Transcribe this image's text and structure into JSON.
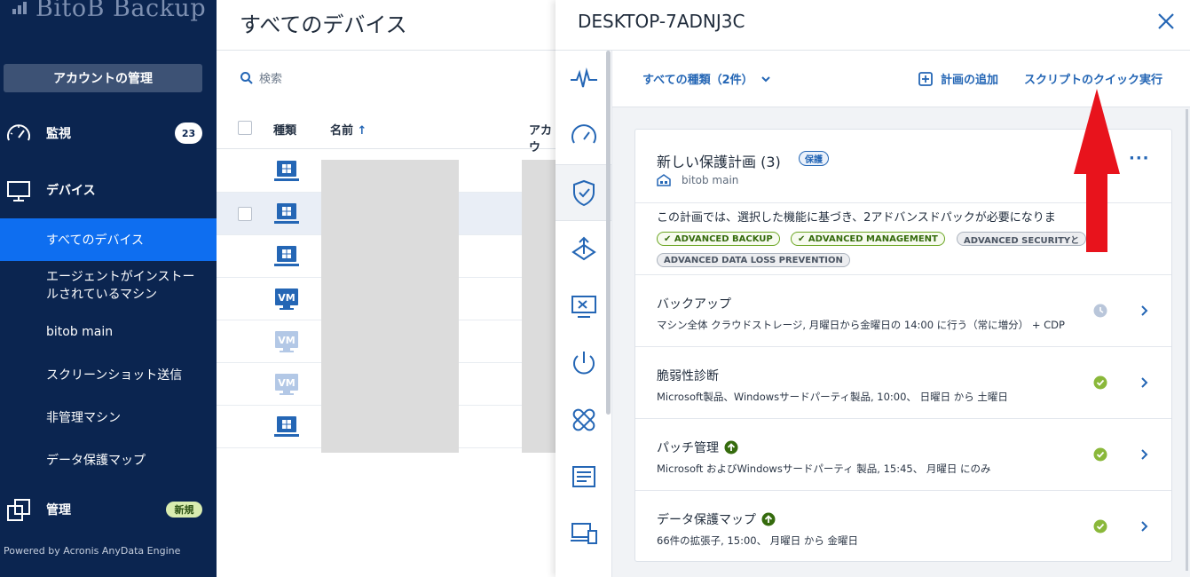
{
  "sidebar": {
    "logo": "BitoB Backup",
    "account_button": "アカウントの管理",
    "monitoring": {
      "label": "監視",
      "count": "23"
    },
    "devices": {
      "label": "デバイス"
    },
    "subitems": [
      "すべてのデバイス",
      "エージェントがインストールされているマシン",
      "bitob main",
      "スクリーンショット送信",
      "非管理マシン",
      "データ保護マップ"
    ],
    "management": {
      "label": "管理",
      "badge": "新規"
    },
    "powered": "Powered by Acronis AnyData Engine"
  },
  "main": {
    "title": "すべてのデバイス",
    "search_placeholder": "検索",
    "columns": {
      "type": "種類",
      "name": "名前",
      "account": "アカウ"
    },
    "rows": [
      {
        "type": "windows"
      },
      {
        "type": "windows",
        "selected": true
      },
      {
        "type": "windows"
      },
      {
        "type": "vm",
        "label": "VM"
      },
      {
        "type": "vm-offline",
        "label": "VM"
      },
      {
        "type": "vm-offline",
        "label": "VM"
      },
      {
        "type": "windows"
      }
    ]
  },
  "panel": {
    "title": "DESKTOP-7ADNJ3C",
    "filter": "すべての種類（2件）",
    "add_plan": "計画の追加",
    "quick_run": "スクリプトのクイック実行",
    "plan": {
      "title": "新しい保護計画 (3)",
      "badge": "保護",
      "org": "bitob main",
      "message": "この計画では、選択した機能に基づき、2アドバンスドパックが必要になりま",
      "packs_enabled": [
        "ADVANCED BACKUP",
        "ADVANCED MANAGEMENT"
      ],
      "packs_disabled": [
        "ADVANCED SECURITYと",
        "ADVANCED DATA LOSS PREVENTION"
      ],
      "sections": [
        {
          "title": "バックアップ",
          "desc": "マシン全体 クラウドストレージ, 月曜日から金曜日の 14:00 に行う（常に増分） + CDP",
          "status": "scheduled"
        },
        {
          "title": "脆弱性診断",
          "desc": "Microsoft製品、Windowsサードパーティ製品, 10:00、 日曜日 から 土曜日",
          "status": "ok"
        },
        {
          "title": "パッチ管理",
          "desc": "Microsoft およびWindowsサードパーティ 製品, 15:45、 月曜日 にのみ",
          "status": "ok",
          "upgrade": true
        },
        {
          "title": "データ保護マップ",
          "desc": "66件の拡張子, 15:00、 月曜日 から 金曜日",
          "status": "ok",
          "upgrade": true
        }
      ]
    }
  },
  "colors": {
    "sidebar": "#0b2550",
    "active": "#0e6ef0",
    "link": "#2466b5",
    "ok": "#8ab83a",
    "arrow": "#e8131c"
  }
}
